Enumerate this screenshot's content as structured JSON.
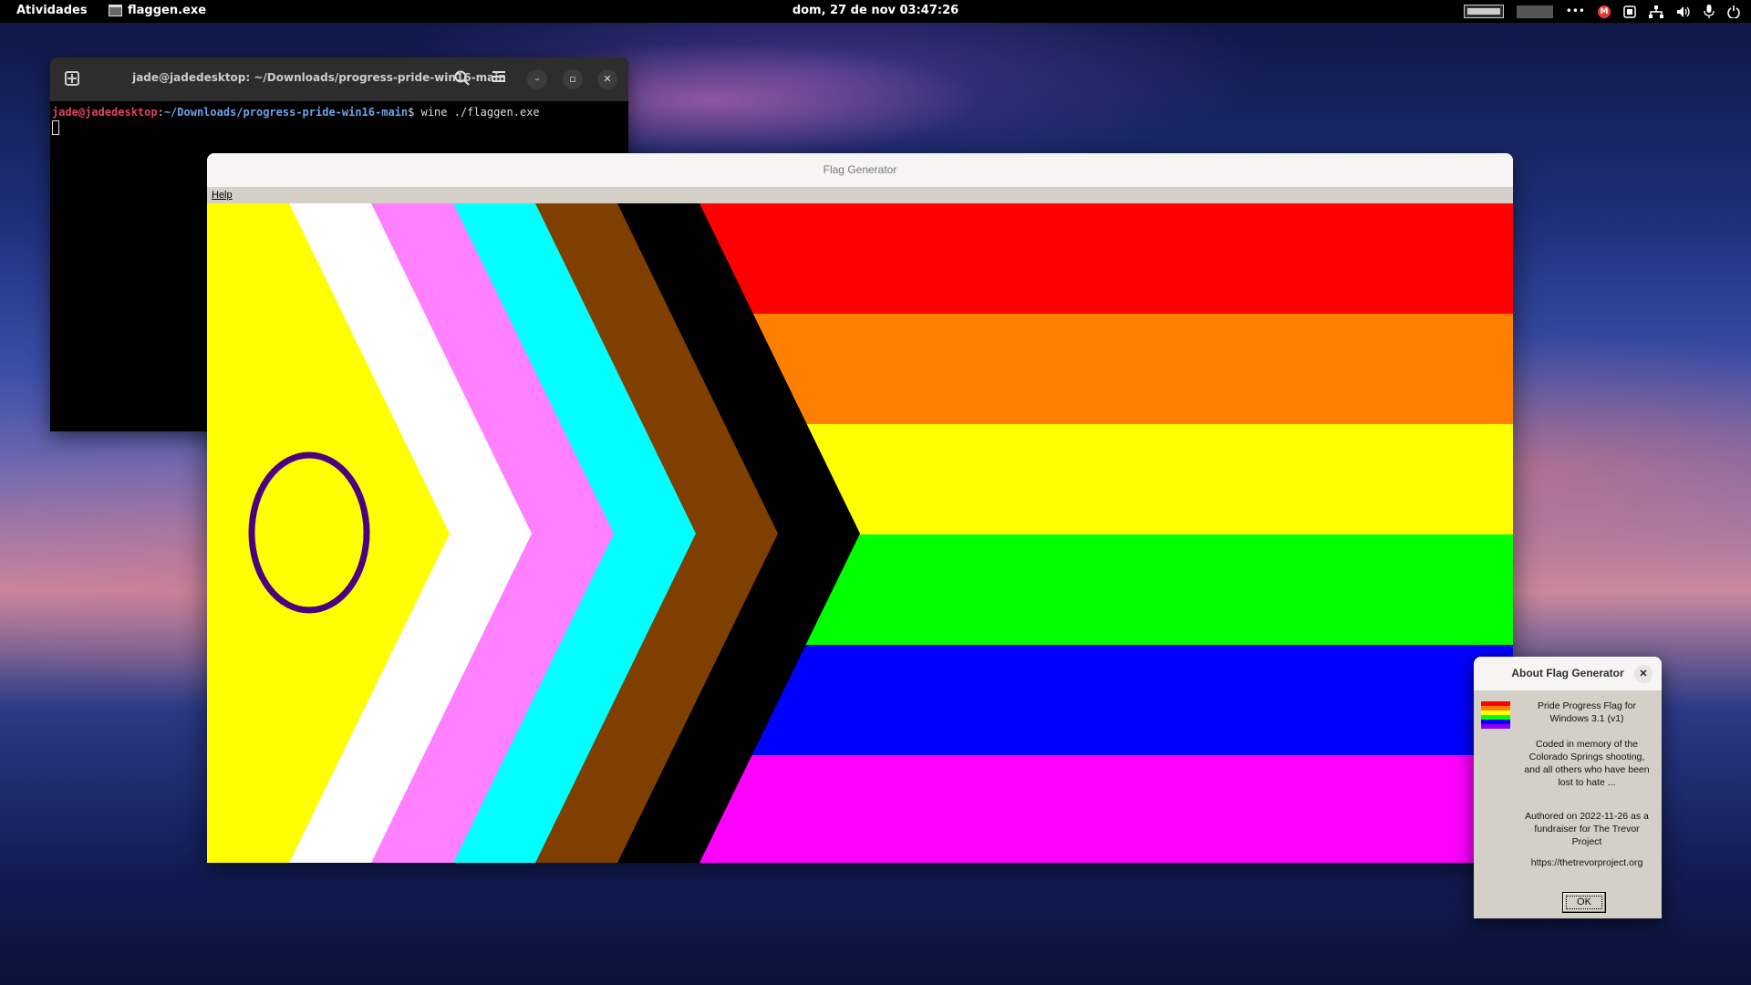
{
  "topbar": {
    "activities": "Atividades",
    "app_name": "flaggen.exe",
    "clock": "dom, 27 de nov  03:47:26",
    "tray_icons": [
      "keyboard-layout-icon",
      "input-indicator-icon",
      "more-icon",
      "mail-badge-icon",
      "screen-icon",
      "network-icon",
      "volume-icon",
      "microphone-icon",
      "power-icon"
    ]
  },
  "terminal": {
    "title": "jade@jadedesktop: ~/Downloads/progress-pride-win16-main",
    "prompt_user": "jade@jadedesktop",
    "prompt_sep": ":",
    "prompt_path": "~/Downloads/progress-pride-win16-main",
    "prompt_symbol": "$ ",
    "command": "wine ./flaggen.exe"
  },
  "flag_window": {
    "title": "Flag Generator",
    "menu": [
      "Help"
    ],
    "flag": {
      "stripes": [
        "#ff0000",
        "#ff8000",
        "#ffff00",
        "#00ff00",
        "#0000ff",
        "#ff00ff"
      ],
      "chevrons": [
        "#000000",
        "#7f3f00",
        "#00ffff",
        "#ff80ff",
        "#ffffff"
      ],
      "field": "#ffff00",
      "ring": "#4b0082"
    }
  },
  "about_dialog": {
    "title": "About Flag Generator",
    "line1": "Pride Progress Flag for Windows 3.1 (v1)",
    "line2": "Coded in memory of the Colorado Springs shooting, and all others who have been lost to hate ...",
    "line3": "Authored on 2022-11-26 as a fundraiser for The Trevor Project",
    "url": "https://thetrevorproject.org",
    "ok_label": "OK"
  }
}
